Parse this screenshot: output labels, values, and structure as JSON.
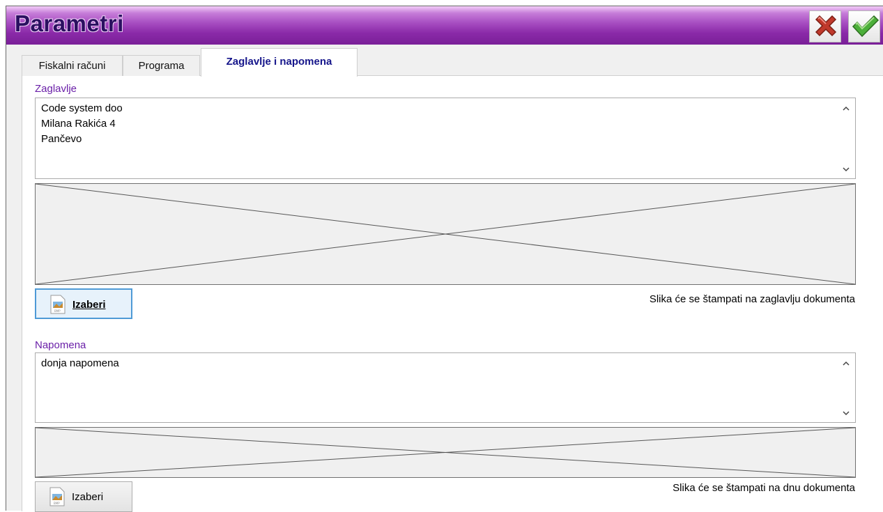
{
  "window": {
    "title": "Parametri"
  },
  "toolbar": {
    "cancel_icon": "close-x-icon",
    "ok_icon": "checkmark-icon"
  },
  "tabs": [
    {
      "label": "Fiskalni računi",
      "active": false
    },
    {
      "label": "Programa",
      "active": false
    },
    {
      "label": "Zaglavlje i napomena",
      "active": true
    }
  ],
  "header_section": {
    "label": "Zaglavlje",
    "lines": [
      "Code system doo",
      "Milana Rakića 4",
      "Pančevo"
    ],
    "button_label": "Izaberi",
    "hint": "Slika će se štampati na zaglavlju dokumenta"
  },
  "footer_section": {
    "label": "Napomena",
    "lines": [
      "donja napomena"
    ],
    "button_label": "Izaberi",
    "hint": "Slika će se štampati na dnu dokumenta"
  },
  "colors": {
    "title_bar": "#8a2aa8",
    "title_text": "#2a1060",
    "active_tab_text": "#14148a",
    "section_label": "#6a1fa8"
  }
}
